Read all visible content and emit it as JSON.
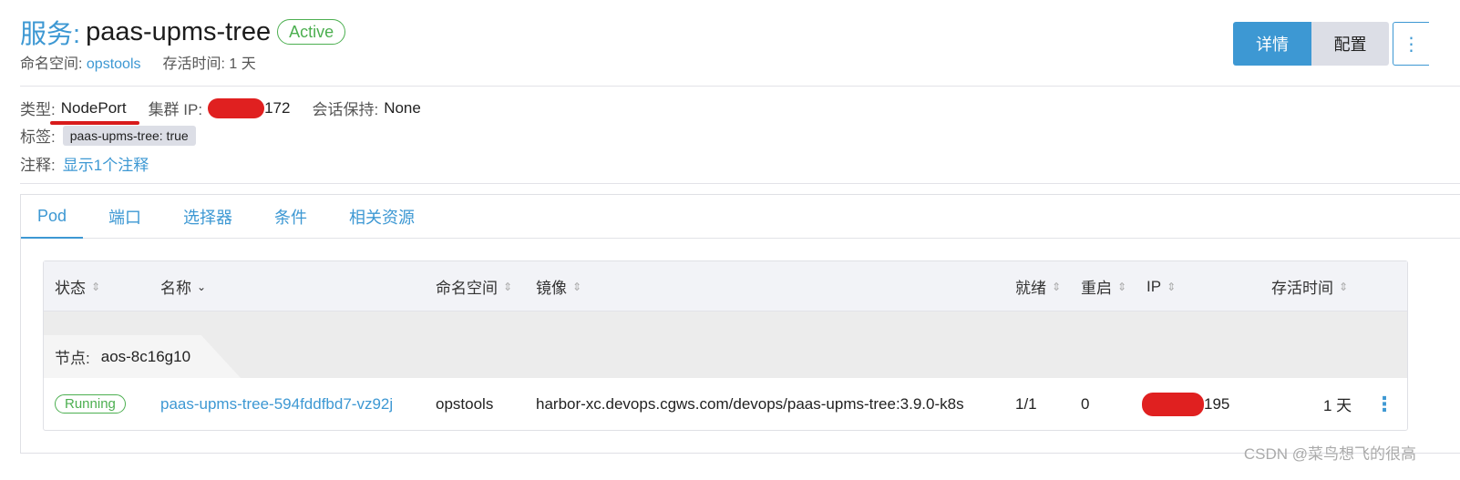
{
  "header": {
    "title_prefix": "服务:",
    "title_name": "paas-upms-tree",
    "status": "Active",
    "namespace_label": "命名空间:",
    "namespace_value": "opstools",
    "age_label": "存活时间:",
    "age_value": "1 天"
  },
  "actions": {
    "detail": "详情",
    "config": "配置",
    "more": "⋮"
  },
  "info": {
    "type_label": "类型:",
    "type_value": "NodePort",
    "cluster_ip_label": "集群 IP:",
    "cluster_ip_suffix": "172",
    "session_label": "会话保持:",
    "session_value": "None",
    "labels_label": "标签:",
    "label_tag": "paas-upms-tree: true",
    "annotations_label": "注释:",
    "annotations_link": "显示1个注释"
  },
  "tabs": [
    "Pod",
    "端口",
    "选择器",
    "条件",
    "相关资源"
  ],
  "table": {
    "columns": [
      "状态",
      "名称",
      "命名空间",
      "镜像",
      "就绪",
      "重启",
      "IP",
      "存活时间"
    ],
    "group": {
      "label": "节点:",
      "value": "aos-8c16g10"
    },
    "rows": [
      {
        "status": "Running",
        "name": "paas-upms-tree-594fddfbd7-vz92j",
        "namespace": "opstools",
        "image": "harbor-xc.devops.cgws.com/devops/paas-upms-tree:3.9.0-k8s",
        "ready": "1/1",
        "restarts": "0",
        "ip_suffix": "195",
        "age": "1 天",
        "menu": "⋮"
      }
    ]
  },
  "watermark": "CSDN @菜鸟想飞的很高",
  "colors": {
    "accent": "#3d98d3",
    "success": "#4caf50",
    "redaction": "#e02020"
  }
}
